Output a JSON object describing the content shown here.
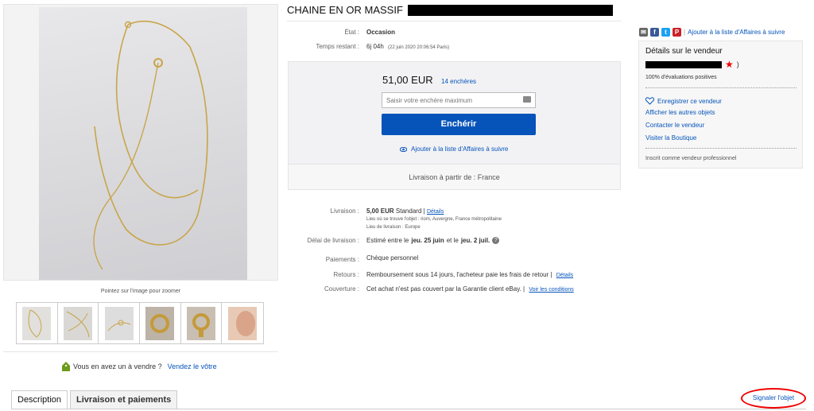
{
  "listing": {
    "title": "CHAINE EN OR MASSIF",
    "condition_label": "État :",
    "condition_value": "Occasion",
    "time_label": "Temps restant :",
    "time_value": "6j 04h",
    "time_detail": "(22 juin 2020   20:06:54 Paris)",
    "price": "51,00 EUR",
    "bids": "14 enchères",
    "bid_placeholder": "Saisir votre enchère maximum",
    "bid_button": "Enchérir",
    "watch_label": "Ajouter à la liste d'Affaires à suivre",
    "ship_from": "Livraison à partir de : France"
  },
  "gallery": {
    "zoom_hint": "Pointez sur l'image pour zoomer",
    "thumb_count": 6,
    "sell_question": "Vous en avez un à vendre ?",
    "sell_link": "Vendez le vôtre"
  },
  "shipping": {
    "label": "Livraison :",
    "price": "5,00 EUR",
    "method": "Standard |",
    "details_link": "Détails",
    "location": "Lieu où se trouve l'objet : riom, Auvergne, France métropolitaine",
    "destination": "Lieu de livraison : Europe",
    "delay_label": "Délai de livraison :",
    "delay_prefix": "Estimé entre le",
    "delay_from": "jeu. 25 juin",
    "delay_mid": "et le",
    "delay_to": "jeu. 2 juil.",
    "payment_label": "Paiements :",
    "payment_value": "Chèque personnel",
    "returns_label": "Retours :",
    "returns_value": "Remboursement sous 14 jours, l'acheteur paie les frais de retour |",
    "returns_link": "Détails",
    "coverage_label": "Couverture :",
    "coverage_value": "Cet achat n'est pas couvert par la Garantie client eBay. |",
    "coverage_link": "Voir les conditions"
  },
  "seller": {
    "share_watch": "Ajouter à la liste d'Affaires à suivre",
    "heading": "Détails sur le vendeur",
    "score_suffix": ")",
    "feedback": "100% d'évaluations positives",
    "save": "Enregistrer ce vendeur",
    "other_items": "Afficher les autres objets",
    "contact": "Contacter le vendeur",
    "store": "Visiter la Boutique",
    "pro": "Inscrit comme vendeur professionnel"
  },
  "tabs": {
    "description": "Description",
    "shipping_payments": "Livraison et paiements",
    "report": "Signaler l'objet"
  },
  "colors": {
    "accent": "#0654ba",
    "highlight": "#e00000"
  }
}
